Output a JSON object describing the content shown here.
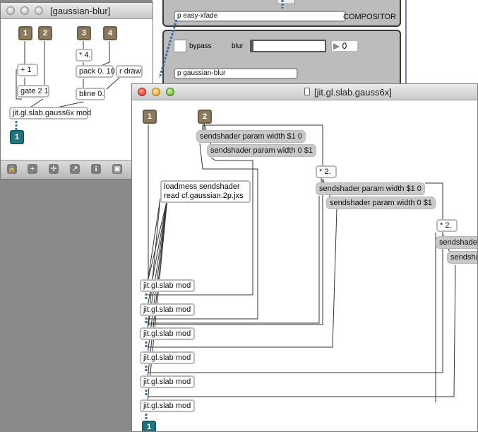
{
  "background_patcher": {
    "compositor": {
      "object": "p easy-xfade",
      "label": "COMPOSITOR"
    },
    "blur_section": {
      "bypass_label": "bypass",
      "blur_label": "blur",
      "number_value": "0",
      "object": "p gaussian-blur"
    }
  },
  "gaussian_window": {
    "title": "[gaussian-blur]",
    "inlets": [
      "1",
      "2",
      "3",
      "4"
    ],
    "objects": {
      "plus": "+ 1",
      "gate": "gate 2 1",
      "times": "* 4.",
      "pack": "pack 0. 10",
      "rdraw": "r draw",
      "bline": "bline 0.",
      "gauss": "jit.gl.slab.gauss6x mod"
    },
    "outlet": "1",
    "toolbar_icons": [
      "lock-icon",
      "plus-icon",
      "move-icon",
      "chart-icon",
      "info-icon",
      "window-icon"
    ],
    "toolbar_glyphs": [
      "🔒",
      "+",
      "✛",
      "↗",
      "i",
      "▣"
    ]
  },
  "gauss6x_window": {
    "title": "[jit.gl.slab.gauss6x]",
    "inlets": [
      "1",
      "2"
    ],
    "messages": {
      "m1": "sendshader param width $1 0",
      "m2": "sendshader param width 0 $1",
      "m3": "sendshader param width $1 0",
      "m4": "sendshader param width 0 $1",
      "m5": "sendshade",
      "m6": "sendsha"
    },
    "times": [
      "* 2.",
      "* 2."
    ],
    "loadmess_line1": "loadmess sendshader",
    "loadmess_line2": "read cf.gaussian.2p.jxs",
    "slabs": [
      "jit.gl.slab mod",
      "jit.gl.slab mod",
      "jit.gl.slab mod",
      "jit.gl.slab mod",
      "jit.gl.slab mod",
      "jit.gl.slab mod"
    ],
    "outlet": "1"
  }
}
